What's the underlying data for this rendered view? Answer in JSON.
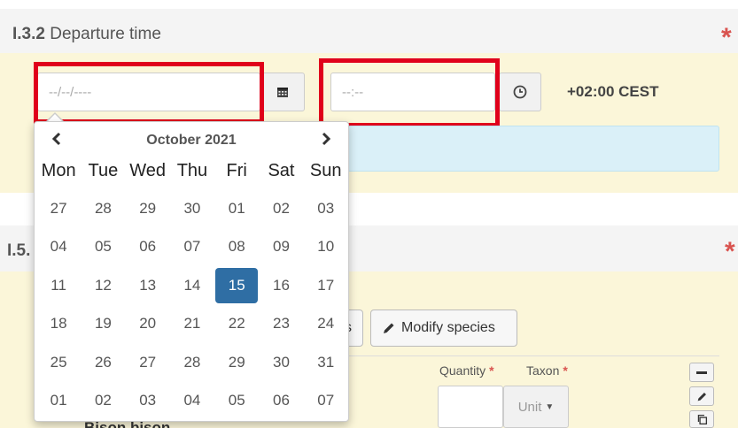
{
  "section_departure": {
    "code": "I.3.2",
    "title": "Departure time",
    "required_star": "*",
    "date_input": {
      "placeholder": "--/--/----"
    },
    "time_input": {
      "placeholder": "--:--"
    },
    "timezone": "+02:00 CEST",
    "icons": {
      "date_addon": "calendar-icon",
      "time_addon": "clock-icon"
    }
  },
  "section_species": {
    "code": "I.5.",
    "required_star": "*",
    "partial_button_text": "s",
    "modify_button": "Modify species",
    "columns": {
      "quantity": "Quantity",
      "taxon": "Taxon",
      "required_star": "*"
    },
    "unit_select": "Unit",
    "species_partial": "Bison bison"
  },
  "datepicker": {
    "month_label": "October 2021",
    "weekdays": [
      "Mon",
      "Tue",
      "Wed",
      "Thu",
      "Fri",
      "Sat",
      "Sun"
    ],
    "selected_day": "15",
    "days": [
      [
        "27",
        "28",
        "29",
        "30",
        "01",
        "02",
        "03"
      ],
      [
        "04",
        "05",
        "06",
        "07",
        "08",
        "09",
        "10"
      ],
      [
        "11",
        "12",
        "13",
        "14",
        "15",
        "16",
        "17"
      ],
      [
        "18",
        "19",
        "20",
        "21",
        "22",
        "23",
        "24"
      ],
      [
        "25",
        "26",
        "27",
        "28",
        "29",
        "30",
        "31"
      ],
      [
        "01",
        "02",
        "03",
        "04",
        "05",
        "06",
        "07"
      ]
    ]
  },
  "colors": {
    "highlight_box": "#e0001b",
    "section_body": "#fbf6d9",
    "selected_day": "#2f6ea4",
    "required": "#d9534f",
    "info_box": "#daf0f8"
  }
}
